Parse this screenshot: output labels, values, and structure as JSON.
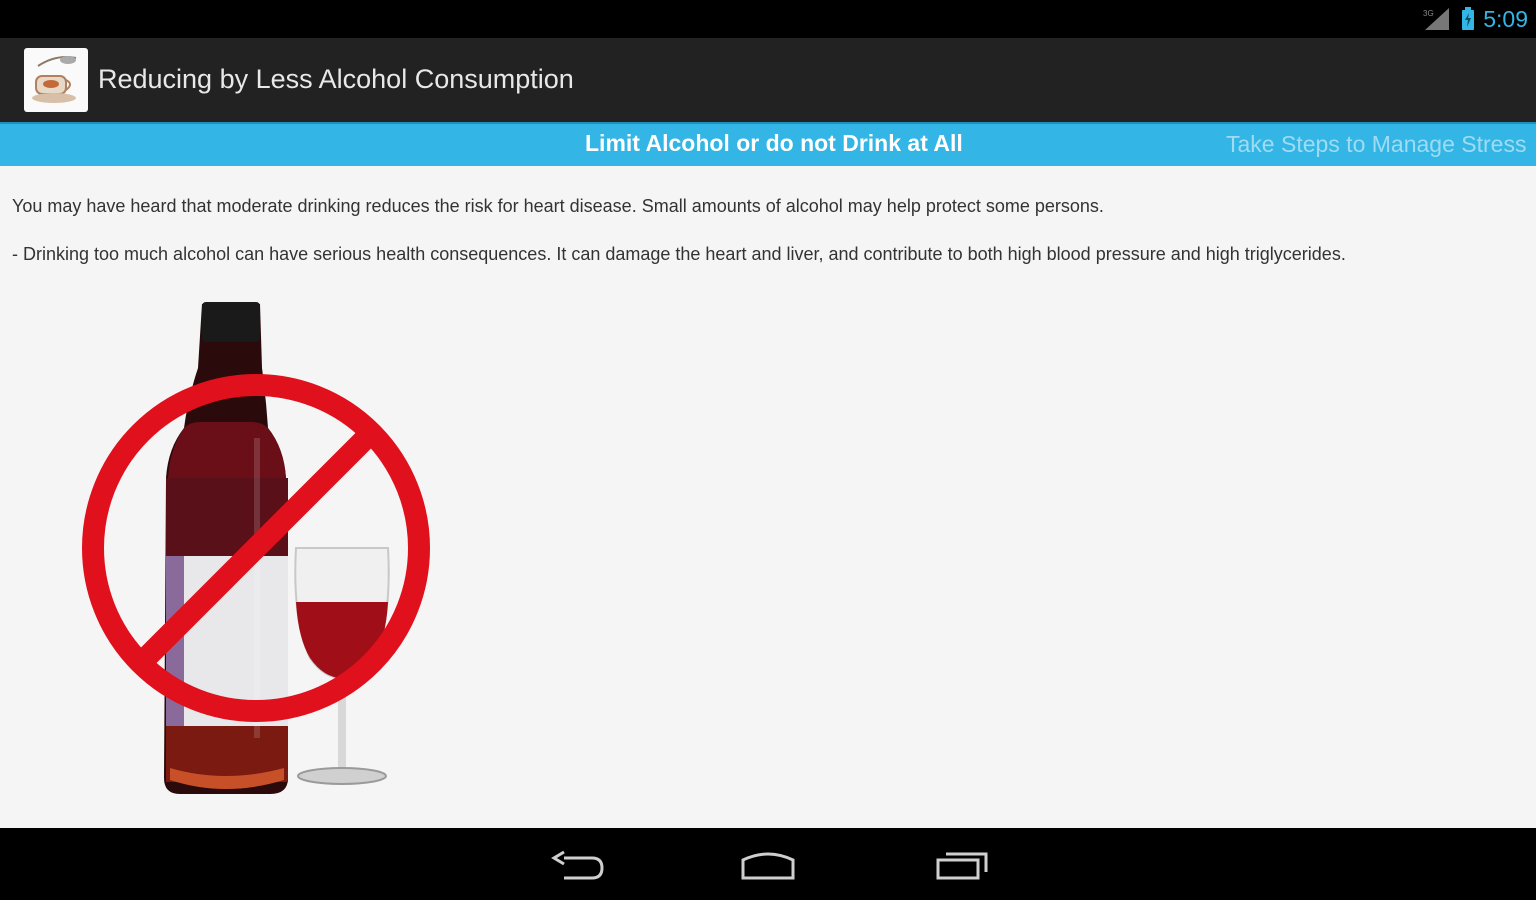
{
  "status_bar": {
    "time": "5:09",
    "colors": {
      "accent": "#33b5e5"
    }
  },
  "action_bar": {
    "title": "Reducing by Less Alcohol Consumption",
    "icon": "coffee-cup-icon"
  },
  "tabs": {
    "current": "Limit Alcohol or do not Drink at All",
    "next": "Take Steps to Manage Stress"
  },
  "content": {
    "paragraphs": [
      "You may have heard that moderate drinking reduces the risk for heart disease. Small amounts of alcohol may help protect some persons.",
      "- Drinking too much alcohol can have serious health consequences. It can damage the heart and liver, and contribute to both high blood pressure and high triglycerides."
    ],
    "image": "no-alcohol-wine-bottle-glass"
  },
  "nav_bar": {
    "buttons": [
      "back-icon",
      "home-icon",
      "recent-apps-icon"
    ]
  }
}
